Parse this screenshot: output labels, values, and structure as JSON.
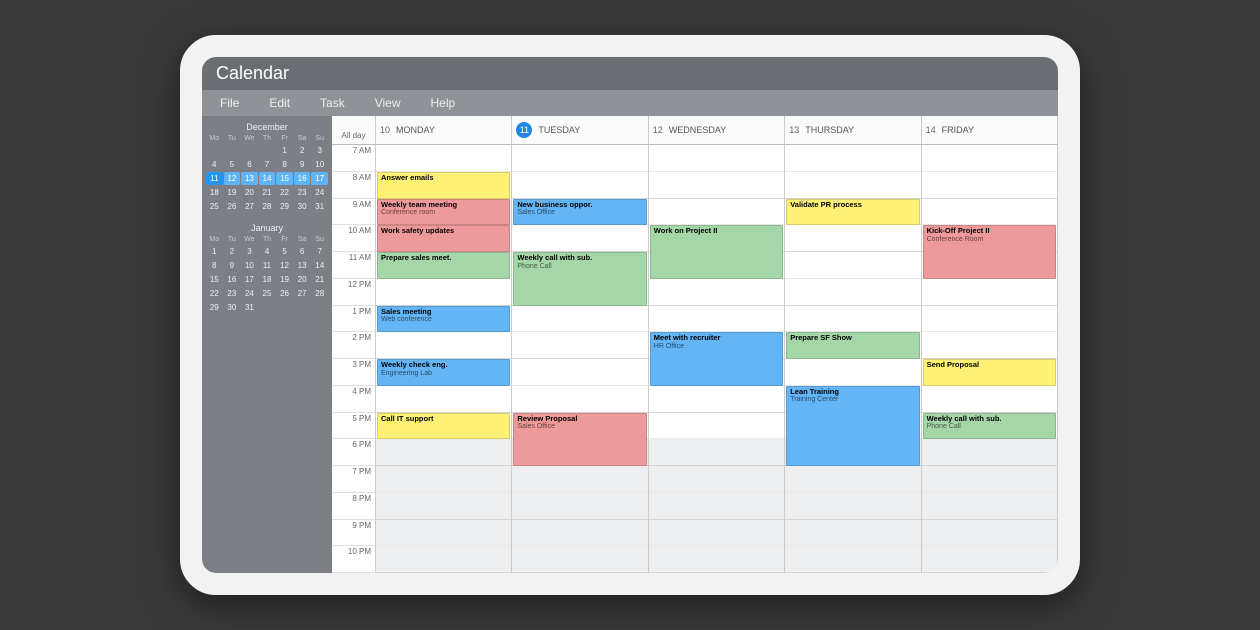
{
  "app_title": "Calendar",
  "menu": [
    "File",
    "Edit",
    "Task",
    "View",
    "Help"
  ],
  "mini_calendars": [
    {
      "title": "December",
      "day_headers": [
        "Mo",
        "Tu",
        "We",
        "Th",
        "Fr",
        "Sa",
        "Su"
      ],
      "weeks": [
        [
          "",
          "",
          "",
          "",
          "1",
          "2",
          "3"
        ],
        [
          "4",
          "5",
          "6",
          "7",
          "8",
          "9",
          "10"
        ],
        [
          "11",
          "12",
          "13",
          "14",
          "15",
          "16",
          "17"
        ],
        [
          "18",
          "19",
          "20",
          "21",
          "22",
          "23",
          "24"
        ],
        [
          "25",
          "26",
          "27",
          "28",
          "29",
          "30",
          "31"
        ]
      ],
      "highlight_week_row": 2,
      "highlight_day": "11"
    },
    {
      "title": "January",
      "day_headers": [
        "Mo",
        "Tu",
        "We",
        "Th",
        "Fr",
        "Sa",
        "Su"
      ],
      "weeks": [
        [
          "1",
          "2",
          "3",
          "4",
          "5",
          "6",
          "7"
        ],
        [
          "8",
          "9",
          "10",
          "11",
          "12",
          "13",
          "14"
        ],
        [
          "15",
          "16",
          "17",
          "18",
          "19",
          "20",
          "21"
        ],
        [
          "22",
          "23",
          "24",
          "25",
          "26",
          "27",
          "28"
        ],
        [
          "29",
          "30",
          "31",
          "",
          "",
          "",
          ""
        ]
      ],
      "highlight_week_row": -1,
      "highlight_day": ""
    }
  ],
  "week": {
    "allday_label": "All day",
    "days": [
      {
        "num": "10",
        "label": "MONDAY",
        "current": false
      },
      {
        "num": "11",
        "label": "TUESDAY",
        "current": true
      },
      {
        "num": "12",
        "label": "WEDNESDAY",
        "current": false
      },
      {
        "num": "13",
        "label": "THURSDAY",
        "current": false
      },
      {
        "num": "14",
        "label": "FRIDAY",
        "current": false
      }
    ],
    "hours": [
      "7 AM",
      "8 AM",
      "9 AM",
      "10 AM",
      "11 AM",
      "12 PM",
      "1 PM",
      "2 PM",
      "3 PM",
      "4 PM",
      "5 PM",
      "6 PM",
      "7 PM",
      "8 PM",
      "9 PM",
      "10 PM"
    ],
    "night_from_index": 11
  },
  "events": [
    {
      "day": 0,
      "start": 1,
      "span": 1,
      "color": "yellow",
      "title": "Answer emails",
      "sub": ""
    },
    {
      "day": 0,
      "start": 2,
      "span": 1,
      "color": "red",
      "title": "Weekly team meeting",
      "sub": "Conference room"
    },
    {
      "day": 0,
      "start": 3,
      "span": 1,
      "color": "red",
      "title": "Work safety updates",
      "sub": ""
    },
    {
      "day": 0,
      "start": 4,
      "span": 1,
      "color": "green",
      "title": "Prepare sales meet.",
      "sub": ""
    },
    {
      "day": 0,
      "start": 6,
      "span": 1,
      "color": "blue",
      "title": "Sales meeting",
      "sub": "Web conference"
    },
    {
      "day": 0,
      "start": 8,
      "span": 1,
      "color": "blue",
      "title": "Weekly check eng.",
      "sub": "Engineering Lab"
    },
    {
      "day": 0,
      "start": 10,
      "span": 1,
      "color": "yellow",
      "title": "Call IT support",
      "sub": ""
    },
    {
      "day": 1,
      "start": 2,
      "span": 1,
      "color": "blue",
      "title": "New business oppor.",
      "sub": "Sales Office"
    },
    {
      "day": 1,
      "start": 4,
      "span": 2,
      "color": "green",
      "title": "Weekly call with sub.",
      "sub": "Phone Call"
    },
    {
      "day": 1,
      "start": 10,
      "span": 2,
      "color": "red",
      "title": "Review Proposal",
      "sub": "Sales Office"
    },
    {
      "day": 2,
      "start": 3,
      "span": 2,
      "color": "green",
      "title": "Work on Project II",
      "sub": ""
    },
    {
      "day": 2,
      "start": 7,
      "span": 2,
      "color": "blue",
      "title": "Meet with recruiter",
      "sub": "HR Office"
    },
    {
      "day": 3,
      "start": 2,
      "span": 1,
      "color": "yellow",
      "title": "Validate PR process",
      "sub": ""
    },
    {
      "day": 3,
      "start": 7,
      "span": 1,
      "color": "green",
      "title": "Prepare SF Show",
      "sub": ""
    },
    {
      "day": 3,
      "start": 9,
      "span": 3,
      "color": "blue",
      "title": "Lean Training",
      "sub": "Training Center"
    },
    {
      "day": 4,
      "start": 3,
      "span": 2,
      "color": "red",
      "title": "Kick-Off Project II",
      "sub": "Conference Room"
    },
    {
      "day": 4,
      "start": 8,
      "span": 1,
      "color": "yellow",
      "title": "Send Proposal",
      "sub": ""
    },
    {
      "day": 4,
      "start": 10,
      "span": 1,
      "color": "green",
      "title": "Weekly call with sub.",
      "sub": "Phone Call"
    }
  ]
}
